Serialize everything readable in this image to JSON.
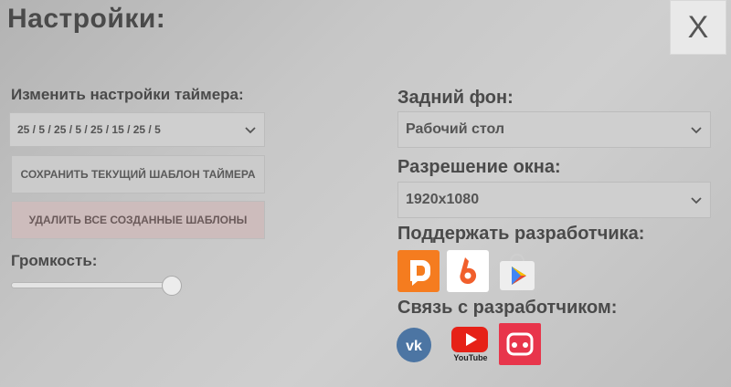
{
  "window": {
    "title": "Настройки:",
    "close_label": "X"
  },
  "timer": {
    "label": "Изменить настройки таймера:",
    "selected_template": "25 / 5 / 25 / 5 / 25 / 15 / 25 / 5",
    "save_template_label": "СОХРАНИТЬ ТЕКУЩИЙ ШАБЛОН ТАЙМЕРА",
    "delete_templates_label": "УДАЛИТЬ ВСЕ СОЗДАННЫЕ ШАБЛОНЫ"
  },
  "volume": {
    "label": "Громкость:",
    "level_fraction": 1.0
  },
  "background": {
    "label": "Задний фон:",
    "selected": "Рабочий стол"
  },
  "resolution": {
    "label": "Разрешение окна:",
    "selected": "1920x1080"
  },
  "support": {
    "label": "Поддержать разработчика:",
    "icons": [
      "donationalerts-icon",
      "boosty-icon",
      "google-play-icon"
    ]
  },
  "contact": {
    "label": "Связь с разработчиком:",
    "icons": [
      "vk-icon",
      "youtube-icon",
      "gamejolt-icon"
    ],
    "youtube_caption": "YouTube"
  },
  "colors": {
    "donationalerts": "#f57c1f",
    "boosty": "#f15f2c",
    "vk": "#4c75a3",
    "youtube": "#e62117",
    "gamejolt": "#e8354b"
  }
}
